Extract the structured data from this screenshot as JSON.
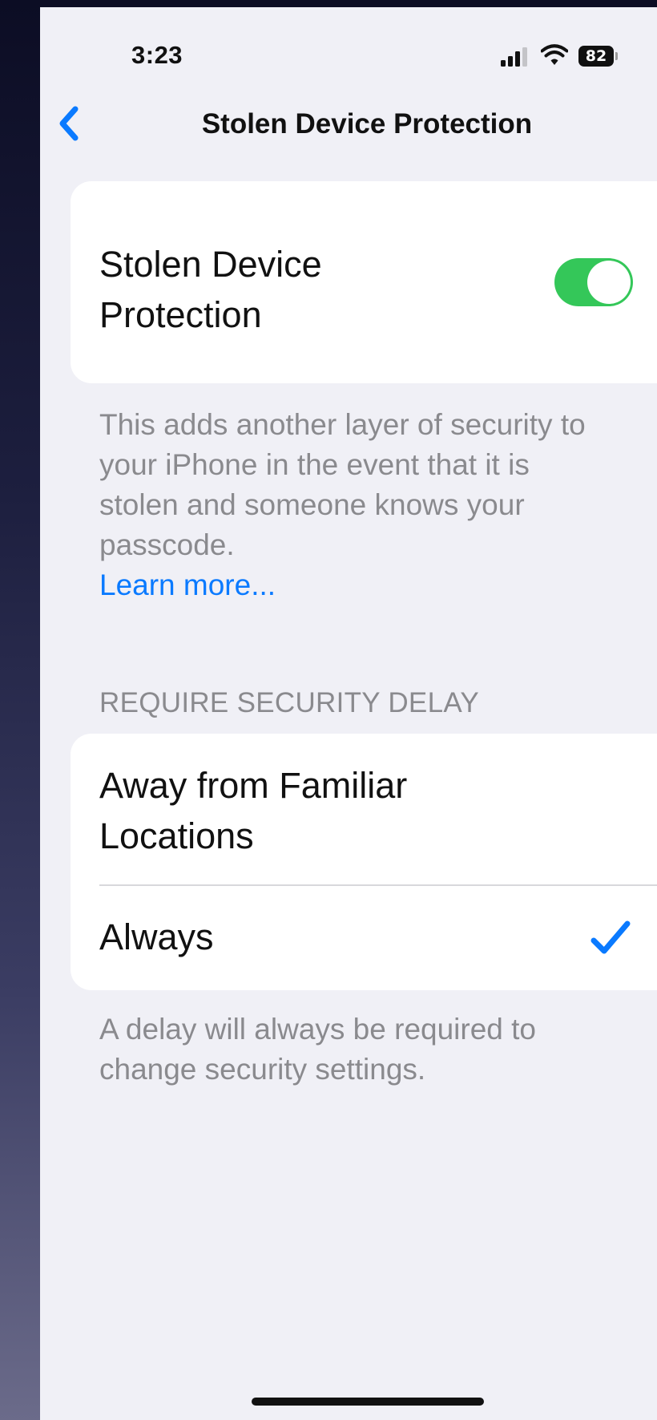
{
  "status_bar": {
    "time": "3:23",
    "battery_level": "82"
  },
  "nav": {
    "title": "Stolen Device Protection",
    "back_icon": "chevron-left-icon"
  },
  "protection": {
    "label": "Stolen Device Protection",
    "enabled": true,
    "description": "This adds another layer of security to your iPhone in the event that it is stolen and someone knows your passcode.",
    "learn_more": "Learn more..."
  },
  "security_delay": {
    "header": "REQUIRE SECURITY DELAY",
    "options": [
      {
        "label": "Away from Familiar Locations",
        "selected": false
      },
      {
        "label": "Always",
        "selected": true
      }
    ],
    "footer": "A delay will always be required to change security settings."
  },
  "colors": {
    "accent": "#0a7aff",
    "toggle_on": "#34c759",
    "background": "#f0f0f6",
    "secondary_text": "#8a8a8e"
  }
}
